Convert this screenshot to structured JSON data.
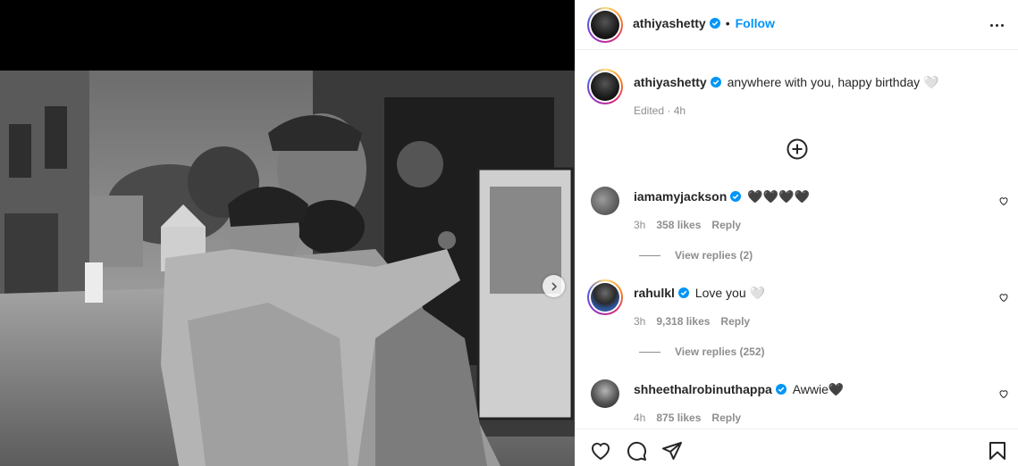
{
  "post": {
    "author": "athiyashetty",
    "follow_label": "Follow",
    "separator": "•",
    "more_icon": "more-horizontal-icon",
    "caption": {
      "username": "athiyashetty",
      "text": "anywhere with you, happy birthday 🤍",
      "meta": "Edited · 4h"
    },
    "load_more_icon": "plus-circle-icon",
    "next_icon": "chevron-right-icon"
  },
  "comments": [
    {
      "username": "iamamyjackson",
      "verified": true,
      "text": "🖤🖤🖤🖤",
      "time": "3h",
      "likes": "358 likes",
      "reply": "Reply",
      "view_replies": "View replies (2)"
    },
    {
      "username": "rahulkl",
      "verified": true,
      "text": "Love you 🤍",
      "time": "3h",
      "likes": "9,318 likes",
      "reply": "Reply",
      "view_replies": "View replies (252)"
    },
    {
      "username": "shheethalrobinuthappa",
      "verified": true,
      "text": "Awwie🖤",
      "time": "4h",
      "likes": "875 likes",
      "reply": "Reply"
    }
  ],
  "actions": {
    "like_icon": "heart-icon",
    "comment_icon": "comment-icon",
    "share_icon": "send-icon",
    "save_icon": "bookmark-icon"
  },
  "colors": {
    "link": "#0095f6",
    "verified": "#0095f6",
    "muted": "#8e8e8e",
    "text": "#262626"
  }
}
